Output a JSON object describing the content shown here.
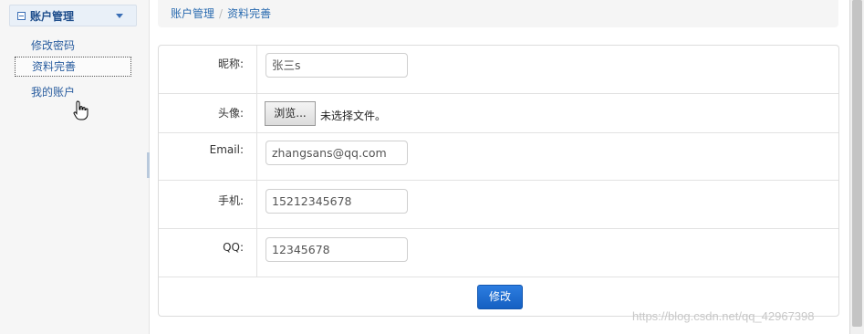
{
  "sidebar": {
    "title": "账户管理",
    "items": [
      {
        "label": "修改密码"
      },
      {
        "label": "资料完善"
      },
      {
        "label": "我的账户"
      }
    ]
  },
  "breadcrumb": {
    "items": [
      "账户管理",
      "资料完善"
    ],
    "separator": "/"
  },
  "form": {
    "nickname": {
      "label": "昵称:",
      "value": "张三s"
    },
    "avatar": {
      "label": "头像:",
      "button": "浏览...",
      "status": "未选择文件。"
    },
    "email": {
      "label": "Email:",
      "value": "zhangsans@qq.com"
    },
    "phone": {
      "label": "手机:",
      "value": "15212345678"
    },
    "qq": {
      "label": "QQ:",
      "value": "12345678"
    },
    "submit": "修改"
  },
  "watermark": "https://blog.csdn.net/qq_42967398",
  "colors": {
    "accent": "#2a6bb0",
    "button": "#1f6fd0"
  }
}
